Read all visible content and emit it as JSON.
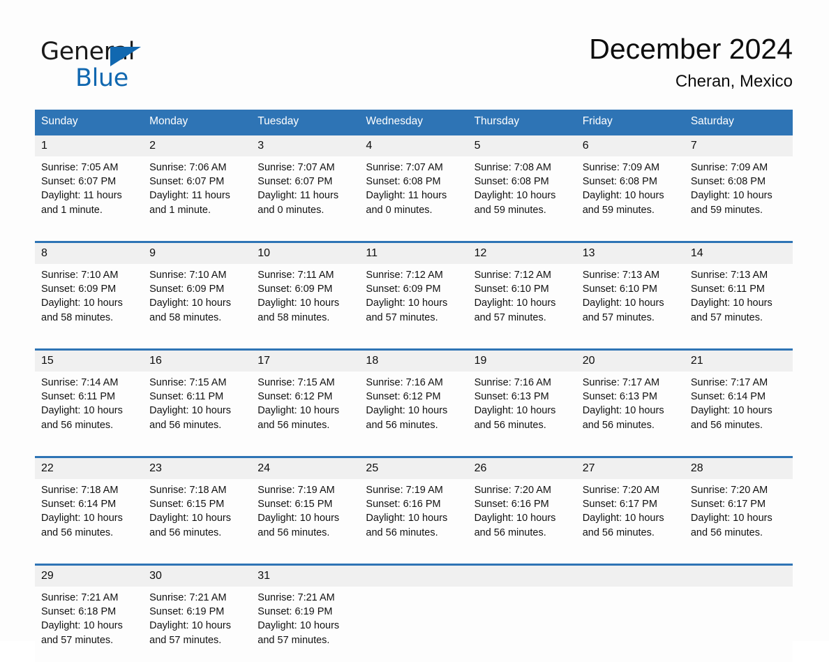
{
  "brand": {
    "name_part1": "General",
    "name_part2": "Blue",
    "flag_color": "#1168b0",
    "accent_color": "#2e74b5"
  },
  "header": {
    "title": "December 2024",
    "location": "Cheran, Mexico"
  },
  "calendar": {
    "weekday_headers": [
      "Sunday",
      "Monday",
      "Tuesday",
      "Wednesday",
      "Thursday",
      "Friday",
      "Saturday"
    ],
    "weeks": [
      {
        "days": [
          {
            "number": "1",
            "sunrise": "Sunrise: 7:05 AM",
            "sunset": "Sunset: 6:07 PM",
            "daylight_line1": "Daylight: 11 hours",
            "daylight_line2": "and 1 minute."
          },
          {
            "number": "2",
            "sunrise": "Sunrise: 7:06 AM",
            "sunset": "Sunset: 6:07 PM",
            "daylight_line1": "Daylight: 11 hours",
            "daylight_line2": "and 1 minute."
          },
          {
            "number": "3",
            "sunrise": "Sunrise: 7:07 AM",
            "sunset": "Sunset: 6:07 PM",
            "daylight_line1": "Daylight: 11 hours",
            "daylight_line2": "and 0 minutes."
          },
          {
            "number": "4",
            "sunrise": "Sunrise: 7:07 AM",
            "sunset": "Sunset: 6:08 PM",
            "daylight_line1": "Daylight: 11 hours",
            "daylight_line2": "and 0 minutes."
          },
          {
            "number": "5",
            "sunrise": "Sunrise: 7:08 AM",
            "sunset": "Sunset: 6:08 PM",
            "daylight_line1": "Daylight: 10 hours",
            "daylight_line2": "and 59 minutes."
          },
          {
            "number": "6",
            "sunrise": "Sunrise: 7:09 AM",
            "sunset": "Sunset: 6:08 PM",
            "daylight_line1": "Daylight: 10 hours",
            "daylight_line2": "and 59 minutes."
          },
          {
            "number": "7",
            "sunrise": "Sunrise: 7:09 AM",
            "sunset": "Sunset: 6:08 PM",
            "daylight_line1": "Daylight: 10 hours",
            "daylight_line2": "and 59 minutes."
          }
        ]
      },
      {
        "days": [
          {
            "number": "8",
            "sunrise": "Sunrise: 7:10 AM",
            "sunset": "Sunset: 6:09 PM",
            "daylight_line1": "Daylight: 10 hours",
            "daylight_line2": "and 58 minutes."
          },
          {
            "number": "9",
            "sunrise": "Sunrise: 7:10 AM",
            "sunset": "Sunset: 6:09 PM",
            "daylight_line1": "Daylight: 10 hours",
            "daylight_line2": "and 58 minutes."
          },
          {
            "number": "10",
            "sunrise": "Sunrise: 7:11 AM",
            "sunset": "Sunset: 6:09 PM",
            "daylight_line1": "Daylight: 10 hours",
            "daylight_line2": "and 58 minutes."
          },
          {
            "number": "11",
            "sunrise": "Sunrise: 7:12 AM",
            "sunset": "Sunset: 6:09 PM",
            "daylight_line1": "Daylight: 10 hours",
            "daylight_line2": "and 57 minutes."
          },
          {
            "number": "12",
            "sunrise": "Sunrise: 7:12 AM",
            "sunset": "Sunset: 6:10 PM",
            "daylight_line1": "Daylight: 10 hours",
            "daylight_line2": "and 57 minutes."
          },
          {
            "number": "13",
            "sunrise": "Sunrise: 7:13 AM",
            "sunset": "Sunset: 6:10 PM",
            "daylight_line1": "Daylight: 10 hours",
            "daylight_line2": "and 57 minutes."
          },
          {
            "number": "14",
            "sunrise": "Sunrise: 7:13 AM",
            "sunset": "Sunset: 6:11 PM",
            "daylight_line1": "Daylight: 10 hours",
            "daylight_line2": "and 57 minutes."
          }
        ]
      },
      {
        "days": [
          {
            "number": "15",
            "sunrise": "Sunrise: 7:14 AM",
            "sunset": "Sunset: 6:11 PM",
            "daylight_line1": "Daylight: 10 hours",
            "daylight_line2": "and 56 minutes."
          },
          {
            "number": "16",
            "sunrise": "Sunrise: 7:15 AM",
            "sunset": "Sunset: 6:11 PM",
            "daylight_line1": "Daylight: 10 hours",
            "daylight_line2": "and 56 minutes."
          },
          {
            "number": "17",
            "sunrise": "Sunrise: 7:15 AM",
            "sunset": "Sunset: 6:12 PM",
            "daylight_line1": "Daylight: 10 hours",
            "daylight_line2": "and 56 minutes."
          },
          {
            "number": "18",
            "sunrise": "Sunrise: 7:16 AM",
            "sunset": "Sunset: 6:12 PM",
            "daylight_line1": "Daylight: 10 hours",
            "daylight_line2": "and 56 minutes."
          },
          {
            "number": "19",
            "sunrise": "Sunrise: 7:16 AM",
            "sunset": "Sunset: 6:13 PM",
            "daylight_line1": "Daylight: 10 hours",
            "daylight_line2": "and 56 minutes."
          },
          {
            "number": "20",
            "sunrise": "Sunrise: 7:17 AM",
            "sunset": "Sunset: 6:13 PM",
            "daylight_line1": "Daylight: 10 hours",
            "daylight_line2": "and 56 minutes."
          },
          {
            "number": "21",
            "sunrise": "Sunrise: 7:17 AM",
            "sunset": "Sunset: 6:14 PM",
            "daylight_line1": "Daylight: 10 hours",
            "daylight_line2": "and 56 minutes."
          }
        ]
      },
      {
        "days": [
          {
            "number": "22",
            "sunrise": "Sunrise: 7:18 AM",
            "sunset": "Sunset: 6:14 PM",
            "daylight_line1": "Daylight: 10 hours",
            "daylight_line2": "and 56 minutes."
          },
          {
            "number": "23",
            "sunrise": "Sunrise: 7:18 AM",
            "sunset": "Sunset: 6:15 PM",
            "daylight_line1": "Daylight: 10 hours",
            "daylight_line2": "and 56 minutes."
          },
          {
            "number": "24",
            "sunrise": "Sunrise: 7:19 AM",
            "sunset": "Sunset: 6:15 PM",
            "daylight_line1": "Daylight: 10 hours",
            "daylight_line2": "and 56 minutes."
          },
          {
            "number": "25",
            "sunrise": "Sunrise: 7:19 AM",
            "sunset": "Sunset: 6:16 PM",
            "daylight_line1": "Daylight: 10 hours",
            "daylight_line2": "and 56 minutes."
          },
          {
            "number": "26",
            "sunrise": "Sunrise: 7:20 AM",
            "sunset": "Sunset: 6:16 PM",
            "daylight_line1": "Daylight: 10 hours",
            "daylight_line2": "and 56 minutes."
          },
          {
            "number": "27",
            "sunrise": "Sunrise: 7:20 AM",
            "sunset": "Sunset: 6:17 PM",
            "daylight_line1": "Daylight: 10 hours",
            "daylight_line2": "and 56 minutes."
          },
          {
            "number": "28",
            "sunrise": "Sunrise: 7:20 AM",
            "sunset": "Sunset: 6:17 PM",
            "daylight_line1": "Daylight: 10 hours",
            "daylight_line2": "and 56 minutes."
          }
        ]
      },
      {
        "days": [
          {
            "number": "29",
            "sunrise": "Sunrise: 7:21 AM",
            "sunset": "Sunset: 6:18 PM",
            "daylight_line1": "Daylight: 10 hours",
            "daylight_line2": "and 57 minutes."
          },
          {
            "number": "30",
            "sunrise": "Sunrise: 7:21 AM",
            "sunset": "Sunset: 6:19 PM",
            "daylight_line1": "Daylight: 10 hours",
            "daylight_line2": "and 57 minutes."
          },
          {
            "number": "31",
            "sunrise": "Sunrise: 7:21 AM",
            "sunset": "Sunset: 6:19 PM",
            "daylight_line1": "Daylight: 10 hours",
            "daylight_line2": "and 57 minutes."
          },
          {
            "number": "",
            "sunrise": "",
            "sunset": "",
            "daylight_line1": "",
            "daylight_line2": ""
          },
          {
            "number": "",
            "sunrise": "",
            "sunset": "",
            "daylight_line1": "",
            "daylight_line2": ""
          },
          {
            "number": "",
            "sunrise": "",
            "sunset": "",
            "daylight_line1": "",
            "daylight_line2": ""
          },
          {
            "number": "",
            "sunrise": "",
            "sunset": "",
            "daylight_line1": "",
            "daylight_line2": ""
          }
        ]
      }
    ]
  }
}
